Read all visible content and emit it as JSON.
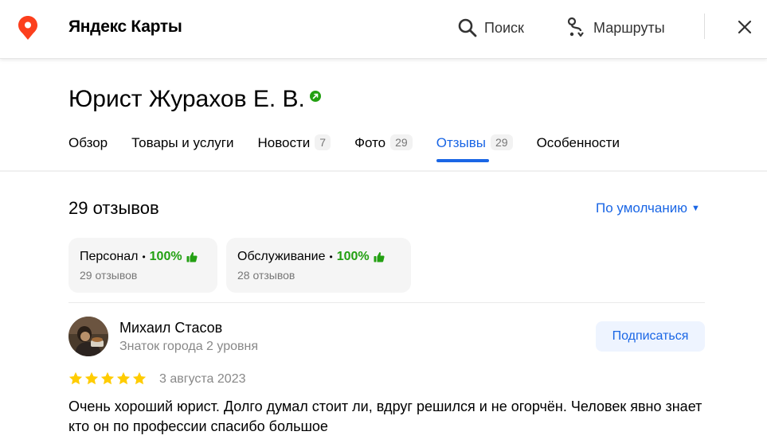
{
  "header": {
    "app_title": "Яндекс Карты",
    "search_label": "Поиск",
    "routes_label": "Маршруты",
    "accent_color": "#fc3f1d"
  },
  "org": {
    "title": "Юрист Журахов Е. В."
  },
  "tabs": [
    {
      "label": "Обзор",
      "count": ""
    },
    {
      "label": "Товары и услуги",
      "count": ""
    },
    {
      "label": "Новости",
      "count": "7"
    },
    {
      "label": "Фото",
      "count": "29"
    },
    {
      "label": "Отзывы",
      "count": "29",
      "active": true
    },
    {
      "label": "Особенности",
      "count": ""
    }
  ],
  "reviews": {
    "count_label": "29 отзывов",
    "sort_label": "По умолчанию",
    "aspects": [
      {
        "name": "Персонал",
        "percent": "100%",
        "sub": "29 отзывов"
      },
      {
        "name": "Обслуживание",
        "percent": "100%",
        "sub": "28 отзывов"
      }
    ],
    "items": [
      {
        "author": "Михаил Стасов",
        "level": "Знаток города 2 уровня",
        "subscribe_label": "Подписаться",
        "rating": 5,
        "date": "3 августа 2023",
        "text": "Очень хороший юрист. Долго думал стоит ли, вдруг решился и не огорчён. Человек явно знает кто он по профессии спасибо большое"
      }
    ]
  },
  "colors": {
    "link_blue": "#1a66e5",
    "positive_green": "#23a012",
    "star_yellow": "#ffcc00"
  }
}
